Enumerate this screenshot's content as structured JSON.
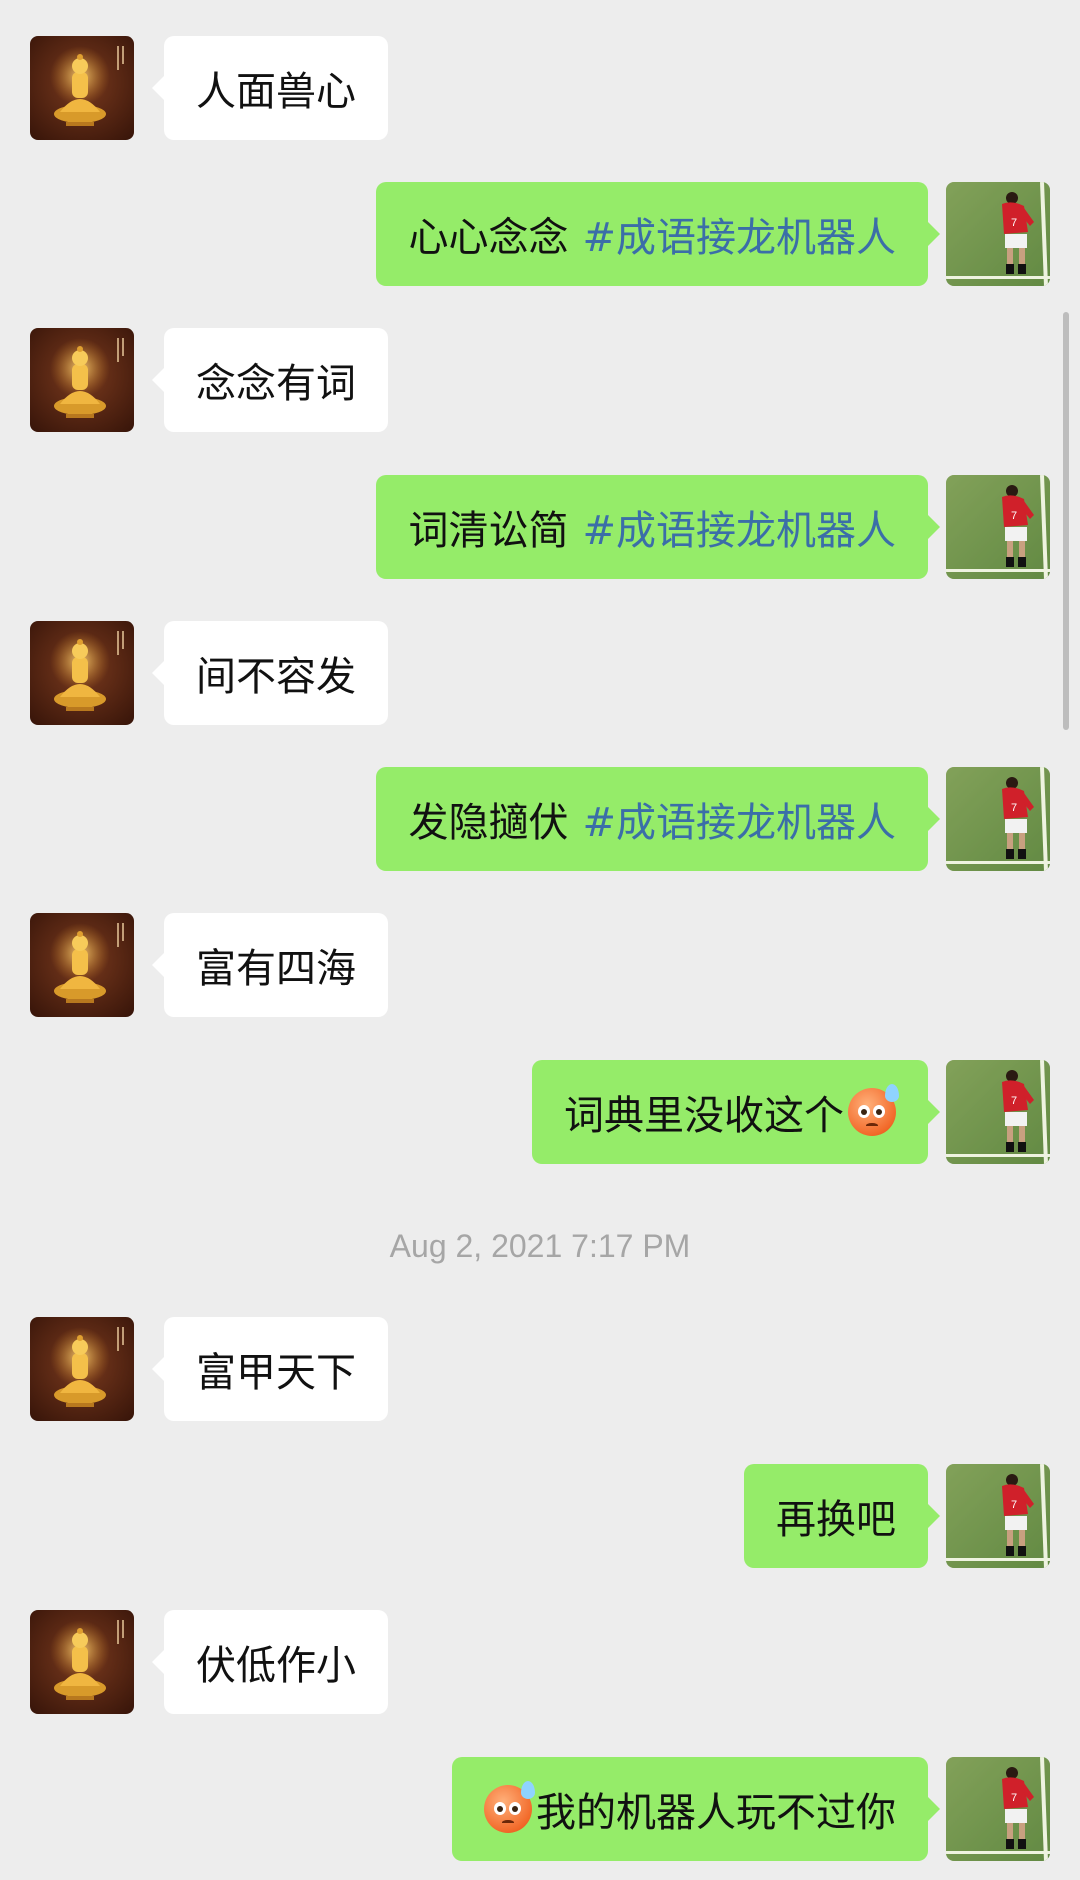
{
  "chat": {
    "timestamp": "Aug 2, 2021 7:17 PM",
    "messages": [
      {
        "dir": "in",
        "text": "人面兽心",
        "tag": null,
        "emoji": null
      },
      {
        "dir": "out",
        "text": "心心念念",
        "tag": "#成语接龙机器人",
        "emoji": null
      },
      {
        "dir": "in",
        "text": "念念有词",
        "tag": null,
        "emoji": null
      },
      {
        "dir": "out",
        "text": "词清讼简",
        "tag": "#成语接龙机器人",
        "emoji": null
      },
      {
        "dir": "in",
        "text": "间不容发",
        "tag": null,
        "emoji": null
      },
      {
        "dir": "out",
        "text": "发隐擿伏",
        "tag": "#成语接龙机器人",
        "emoji": null
      },
      {
        "dir": "in",
        "text": "富有四海",
        "tag": null,
        "emoji": null
      },
      {
        "dir": "out",
        "text": "词典里没收这个",
        "tag": null,
        "emoji": "anxious-sweat-face-icon",
        "emoji_position": "after"
      },
      {
        "dir": "in",
        "text": "富甲天下",
        "tag": null,
        "emoji": null
      },
      {
        "dir": "out",
        "text": "再换吧",
        "tag": null,
        "emoji": null
      },
      {
        "dir": "in",
        "text": "伏低作小",
        "tag": null,
        "emoji": null
      },
      {
        "dir": "out",
        "text": "我的机器人玩不过你",
        "tag": null,
        "emoji": "anxious-sweat-face-icon",
        "emoji_position": "before"
      }
    ],
    "avatars": {
      "incoming": "buddha-avatar",
      "outgoing": "football-player-avatar"
    }
  },
  "colors": {
    "background": "#ededed",
    "incoming_bubble": "#ffffff",
    "outgoing_bubble": "#95ec69",
    "tag_text": "#3b6ea8",
    "timestamp_text": "#a6a6a6"
  }
}
